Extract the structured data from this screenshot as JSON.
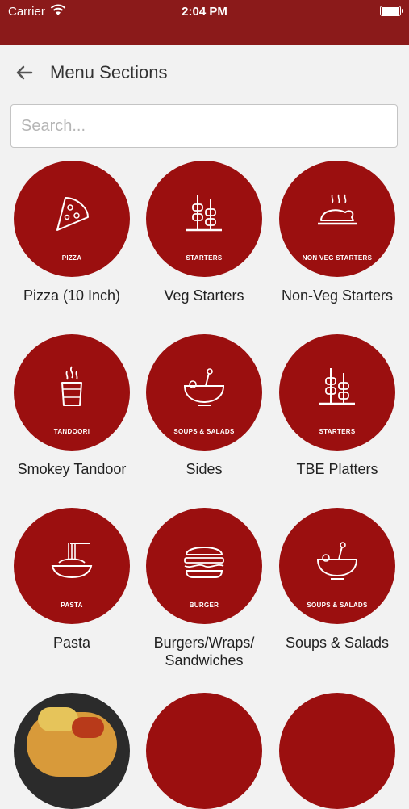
{
  "status_bar": {
    "carrier": "Carrier",
    "time": "2:04 PM"
  },
  "header": {
    "title": "Menu Sections"
  },
  "search": {
    "placeholder": "Search..."
  },
  "sections": [
    {
      "label": "Pizza (10 Inch)",
      "caption": "PIZZA",
      "icon": "pizza-icon"
    },
    {
      "label": "Veg Starters",
      "caption": "STARTERS",
      "icon": "skewers-icon"
    },
    {
      "label": "Non-Veg Starters",
      "caption": "NON VEG STARTERS",
      "icon": "chicken-icon"
    },
    {
      "label": "Smokey Tandoor",
      "caption": "TANDOORI",
      "icon": "tandoor-icon"
    },
    {
      "label": "Sides",
      "caption": "SOUPS & SALADS",
      "icon": "bowl-icon"
    },
    {
      "label": "TBE Platters",
      "caption": "STARTERS",
      "icon": "skewers-icon"
    },
    {
      "label": "Pasta",
      "caption": "PASTA",
      "icon": "pasta-icon"
    },
    {
      "label": "Burgers/Wraps/ Sandwiches",
      "caption": "BURGER",
      "icon": "burger-icon"
    },
    {
      "label": "Soups & Salads",
      "caption": "SOUPS & SALADS",
      "icon": "bowl-icon"
    }
  ],
  "colors": {
    "header": "#8b1a1a",
    "circle": "#9b0f0f",
    "background": "#f2f2f2"
  }
}
